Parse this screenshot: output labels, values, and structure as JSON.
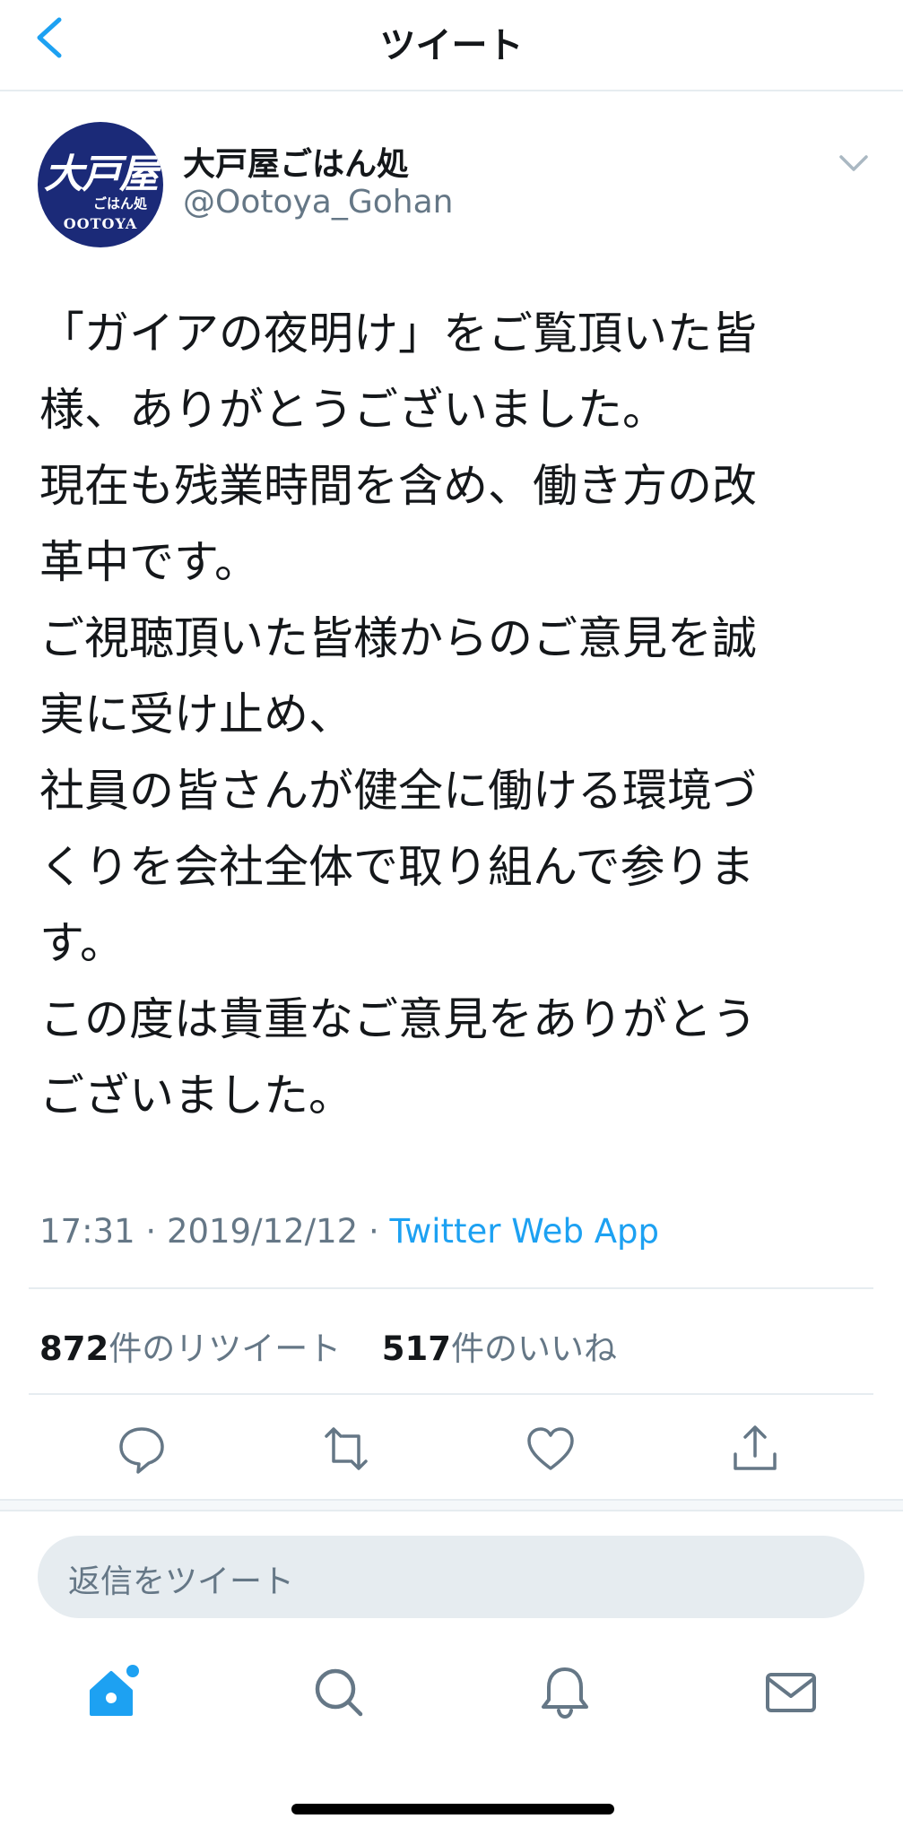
{
  "header": {
    "title": "ツイート"
  },
  "author": {
    "display_name": "大戸屋ごはん処",
    "handle": "@Ootoya_Gohan",
    "avatar_text_big": "大戸屋",
    "avatar_text_small": "ごはん処",
    "avatar_text_en": "OOTOYA"
  },
  "tweet": {
    "text": "「ガイアの夜明け」をご覧頂いた皆\n様、ありがとうございました。\n現在も残業時間を含め、働き方の改\n革中です。\nご視聴頂いた皆様からのご意見を誠\n実に受け止め、\n社員の皆さんが健全に働ける環境づ\nくりを会社全体で取り組んで参りま\nす。\nこの度は貴重なご意見をありがとう\nございました。",
    "time": "17:31",
    "separator": " · ",
    "date": "2019/12/12",
    "source": "Twitter Web App"
  },
  "stats": {
    "retweets_count": "872",
    "retweets_label": "件のリツイート",
    "likes_count": "517",
    "likes_label": "件のいいね"
  },
  "reply": {
    "placeholder": "返信をツイート"
  },
  "colors": {
    "accent": "#1da1f2",
    "secondary_text": "#657786",
    "avatar_bg": "#1b2a78"
  },
  "icons": {
    "back": "chevron-left-icon",
    "menu": "chevron-down-icon",
    "reply": "reply-icon",
    "retweet": "retweet-icon",
    "like": "heart-icon",
    "share": "share-icon",
    "home": "home-icon",
    "search": "search-icon",
    "notifications": "bell-icon",
    "messages": "mail-icon"
  }
}
